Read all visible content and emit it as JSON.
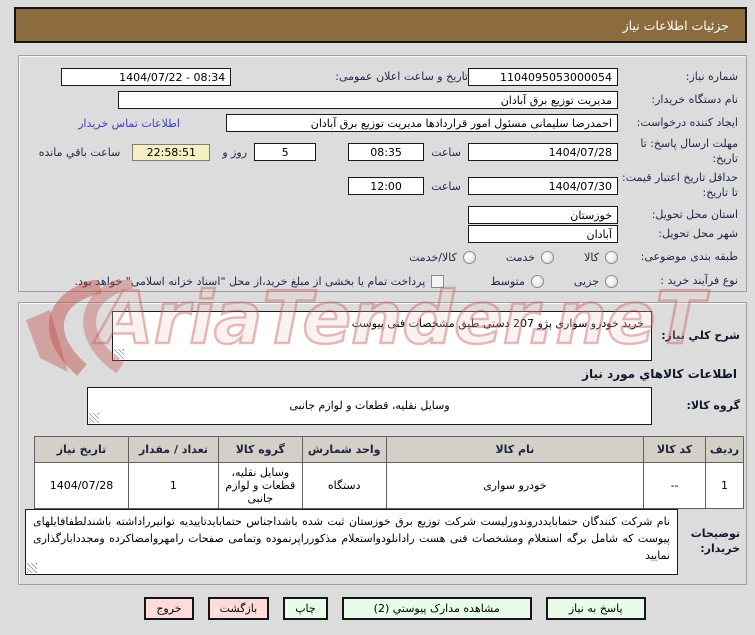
{
  "header": {
    "title": "جزئیات اطلاعات نیاز"
  },
  "watermark": {
    "text": "AriaTender.neT"
  },
  "colors": {
    "header_brown": "#8c6b3e",
    "button_green": "#e9fbe9",
    "button_pink": "#ffdbdb",
    "countdown_yellow": "#f5efc3",
    "link_blue": "#3c3ccc",
    "table_header_gray": "#d4d0c8"
  },
  "form": {
    "need_number": {
      "label": "شماره نیاز:",
      "value": "1104095053000054"
    },
    "announce_datetime": {
      "label": "تاریخ و ساعت اعلان عمومی:",
      "value": "1404/07/22 - 08:34"
    },
    "buyer_org": {
      "label": "نام دستگاه خریدار:",
      "value": "مدیریت توزیع برق آبادان"
    },
    "request_creator": {
      "label": "ایجاد کننده درخواست:",
      "value": "احمدرضا سلیمانی مسئول امور قراردادها مدیریت توزیع برق آبادان",
      "contact_link": "اطلاعات تماس خریدار"
    },
    "reply_deadline": {
      "label": "مهلت ارسال پاسخ: تا تاریخ:",
      "date": "1404/07/28",
      "hour_label": "ساعت",
      "time": "08:35",
      "days": "5",
      "days_label": "روز و",
      "countdown": "22:58:51",
      "countdown_label": "ساعت باقي مانده"
    },
    "price_validity": {
      "label": "حداقل تاریخ اعتبار قیمت: تا تاریخ:",
      "date": "1404/07/30",
      "hour_label": "ساعت",
      "time": "12:00"
    },
    "province": {
      "label": "استان محل تحویل:",
      "value": "خوزستان"
    },
    "city": {
      "label": "شهر محل تحویل:",
      "value": "آبادان"
    },
    "subject_class": {
      "label": "طبقه بندی موضوعی:",
      "options": [
        "کالا",
        "خدمت",
        "کالا/خدمت"
      ]
    },
    "process_type": {
      "label": "نوع فرآیند خرید :",
      "options": [
        "جزیی",
        "متوسط"
      ],
      "checkbox_label": "پرداخت تمام یا بخشی از مبلغ خرید،از محل \"اسناد خزانه اسلامی\" خواهد بود."
    },
    "need_desc": {
      "label": "شرح کلي نیاز:",
      "value": "خرید خودرو سواری پژو 207 دستی طبق مشخصات فنی پیوست"
    },
    "goods_section_title": "اطلاعات کالاهاي مورد نیاز",
    "goods_group": {
      "label": "گروه کالا:",
      "value": "وسایل نقلیه، قطعات و لوازم جانبی"
    },
    "buyer_notes": {
      "label": "توضیحات خریدار:",
      "value": "نام شرکت کنندگان حتمابایددروندورلیست شرکت توزیع برق خوزستان ثبت شده باشداجناس حتمابایدتاییدیه توانیرراداشته باشندلطفافایلهای پیوست که شامل برگه استعلام ومشخصات فنی هست رادانلودواستعلام مذکورراپرنموده وتمامی صفحات رامهروامضاکرده ومجددابارگذاری نمایید"
    }
  },
  "table": {
    "headers": [
      "ردیف",
      "کد کالا",
      "نام کالا",
      "واحد شمارش",
      "گروه کالا",
      "تعداد / مقدار",
      "تاریخ نیاز"
    ],
    "rows": [
      [
        "1",
        "--",
        "خودرو سواری",
        "دستگاه",
        "وسایل نقلیه، قطعات و لوازم جانبی",
        "1",
        "1404/07/28"
      ]
    ]
  },
  "buttons": [
    {
      "label": "پاسخ به نیاز"
    },
    {
      "label": "مشاهده مدارک پیوستي (2)"
    },
    {
      "label": "چاپ"
    },
    {
      "label": "بازگشت"
    },
    {
      "label": "خروج"
    }
  ]
}
